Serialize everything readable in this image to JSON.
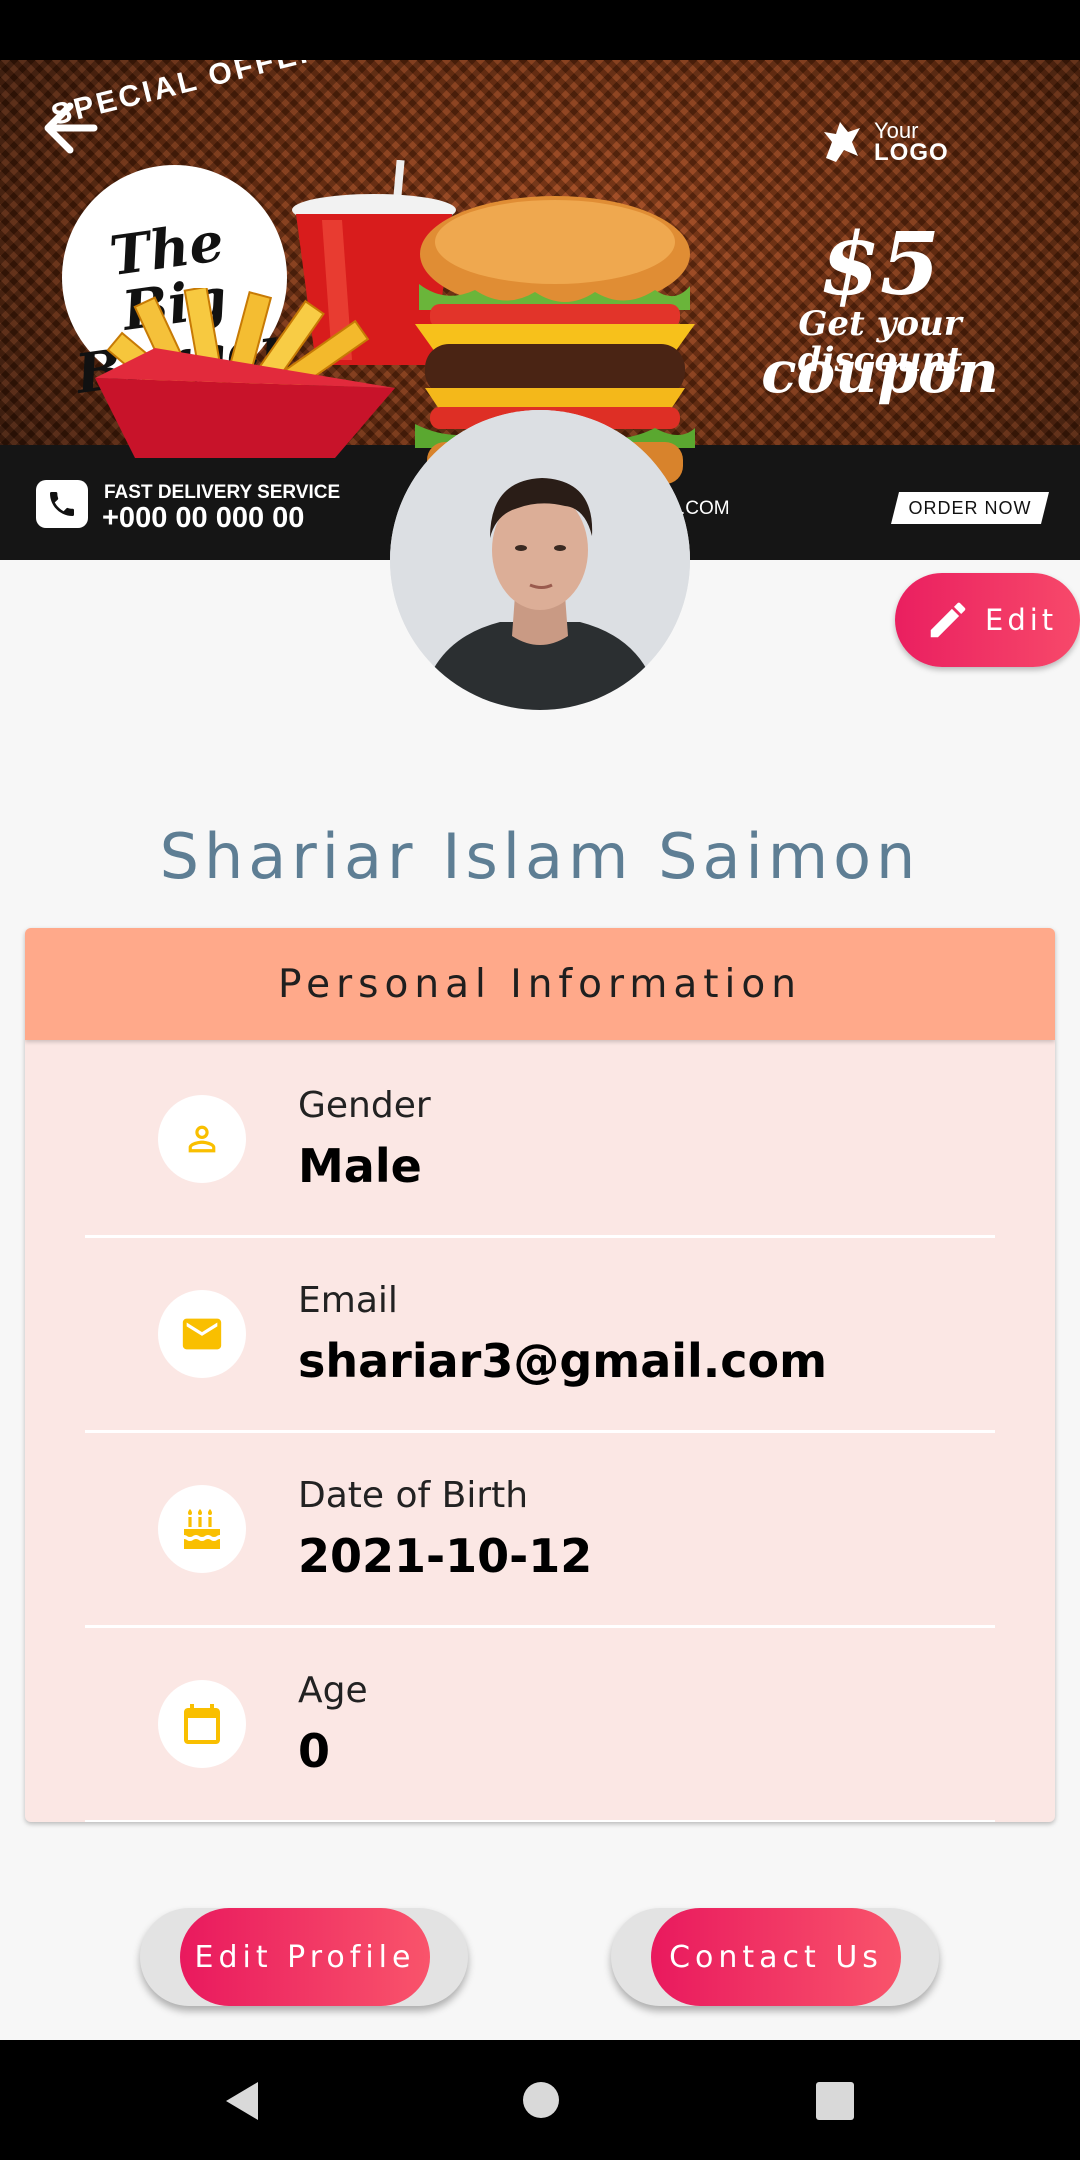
{
  "banner": {
    "special_offer": "SPECIAL OFFER",
    "title_line1": "The Big",
    "title_line2": "Burger",
    "logo_line1": "Your",
    "logo_line2": "LOGO",
    "price": "$5",
    "discount_line": "Get your discount",
    "coupon_line": "coupon",
    "delivery_label": "FAST DELIVERY SERVICE",
    "delivery_phone": "+000 00 000 00",
    "website_fragment": ".COM",
    "order_button": "ORDER NOW"
  },
  "profile": {
    "name": "Shariar Islam Saimon",
    "edit_label": "Edit"
  },
  "personal_info": {
    "header": "Personal Information",
    "rows": [
      {
        "label": "Gender",
        "value": "Male",
        "icon": "person-icon"
      },
      {
        "label": "Email",
        "value": "shariar3@gmail.com",
        "icon": "email-icon"
      },
      {
        "label": "Date of Birth",
        "value": "2021-10-12",
        "icon": "cake-icon"
      },
      {
        "label": "Age",
        "value": "0",
        "icon": "calendar-icon"
      }
    ]
  },
  "actions": {
    "edit_profile": "Edit Profile",
    "contact_us": "Contact Us"
  },
  "colors": {
    "accent_pink": "#ea1f60",
    "header_peach": "#ffa98a",
    "card_bg": "#fbe7e4",
    "icon_yellow": "#f9bf00",
    "name_color": "#5e7e94"
  }
}
